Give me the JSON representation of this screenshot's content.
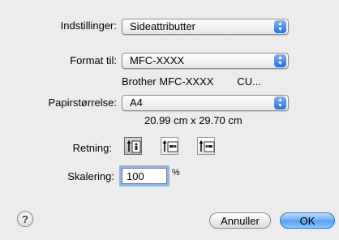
{
  "settings": {
    "label": "Indstillinger:",
    "value": "Sideattributter"
  },
  "format": {
    "label": "Format til:",
    "value": "MFC-XXXX",
    "description": "Brother MFC-XXXX        CU..."
  },
  "paper": {
    "label": "Papirstørrelse:",
    "value": "A4",
    "dimensions": "20.99 cm x 29.70 cm"
  },
  "orientation": {
    "label": "Retning:",
    "options": [
      "portrait",
      "landscape-left",
      "landscape-right"
    ],
    "selected": "portrait"
  },
  "scaling": {
    "label": "Skalering:",
    "value": "100",
    "unit": "%"
  },
  "buttons": {
    "help": "?",
    "cancel": "Annuller",
    "ok": "OK"
  }
}
